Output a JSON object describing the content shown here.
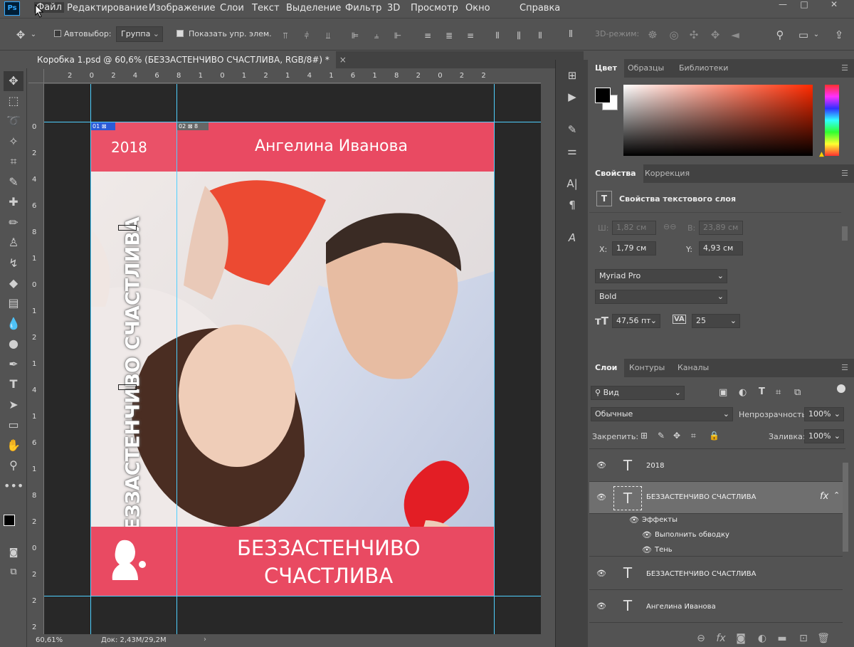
{
  "app": {
    "logo": "Ps"
  },
  "menu": [
    "Файл",
    "Редактирование",
    "Изображение",
    "Слои",
    "Текст",
    "Выделение",
    "Фильтр",
    "3D",
    "Просмотр",
    "Окно",
    "Справка"
  ],
  "window_buttons": [
    "—",
    "□",
    "✕"
  ],
  "options": {
    "move_icon": "move-icon",
    "autoselect_label": "Автовыбор:",
    "autoselect_value": "Группа",
    "show_transform_label": "Показать упр. элем.",
    "mode_3d_label": "3D-режим:"
  },
  "document": {
    "tab_title": "Коробка 1.psd @ 60,6% (БЕЗЗАСТЕНЧИВО СЧАСТЛИВА, RGB/8#) *",
    "tab_close": "×",
    "zoom": "60,61%",
    "doc_info": "Док: 2,43M/29,2M",
    "slice_01": "01",
    "slice_02": "02",
    "slice_02_num": "8"
  },
  "ruler_top": [
    "2",
    "0",
    "2",
    "4",
    "6",
    "8",
    "1",
    "0",
    "1",
    "2",
    "1",
    "4",
    "1",
    "6",
    "1",
    "8",
    "2",
    "0",
    "2",
    "2"
  ],
  "ruler_left": [
    "0",
    "2",
    "4",
    "6",
    "8",
    "1",
    "0",
    "1",
    "2",
    "1",
    "4",
    "1",
    "6",
    "1",
    "8",
    "2",
    "0",
    "2",
    "2",
    "2",
    "4"
  ],
  "cover": {
    "year": "2018",
    "author": "Ангелина Иванова",
    "spine_title": "БЕЗЗАСТЕНЧИВО СЧАСТЛИВА",
    "title_line1": "БЕЗЗАСТЕНЧИВО",
    "title_line2": "СЧАСТЛИВА",
    "accent": "#e94a62"
  },
  "color_panel": {
    "tabs": [
      "Цвет",
      "Образцы",
      "Библиотеки"
    ],
    "fg": "#000000",
    "bg": "#ffffff",
    "hue": "#ff2a00"
  },
  "properties_panel": {
    "tabs": [
      "Свойства",
      "Коррекция"
    ],
    "title": "Свойства текстового слоя",
    "w_label": "Ш:",
    "w_value": "1,82 см",
    "h_label": "В:",
    "h_value": "23,89 см",
    "x_label": "X:",
    "x_value": "1,79 см",
    "y_label": "Y:",
    "y_value": "4,93 см",
    "font": "Myriad Pro",
    "style": "Bold",
    "size": "47,56 пт",
    "tracking": "25"
  },
  "layers_panel": {
    "tabs": [
      "Слои",
      "Контуры",
      "Каналы"
    ],
    "filter": "Вид",
    "blend": "Обычные",
    "opacity_label": "Непрозрачность:",
    "opacity": "100%",
    "lock_label": "Закрепить:",
    "fill_label": "Заливка:",
    "fill": "100%",
    "fx": "fx",
    "effects_label": "Эффекты",
    "effect_stroke": "Выполнить обводку",
    "effect_shadow": "Тень",
    "layers": [
      "2018",
      "БЕЗЗАСТЕНЧИВО СЧАСТЛИВА",
      "БЕЗЗАСТЕНЧИВО СЧАСТЛИВА",
      "Ангелина Иванова"
    ]
  }
}
